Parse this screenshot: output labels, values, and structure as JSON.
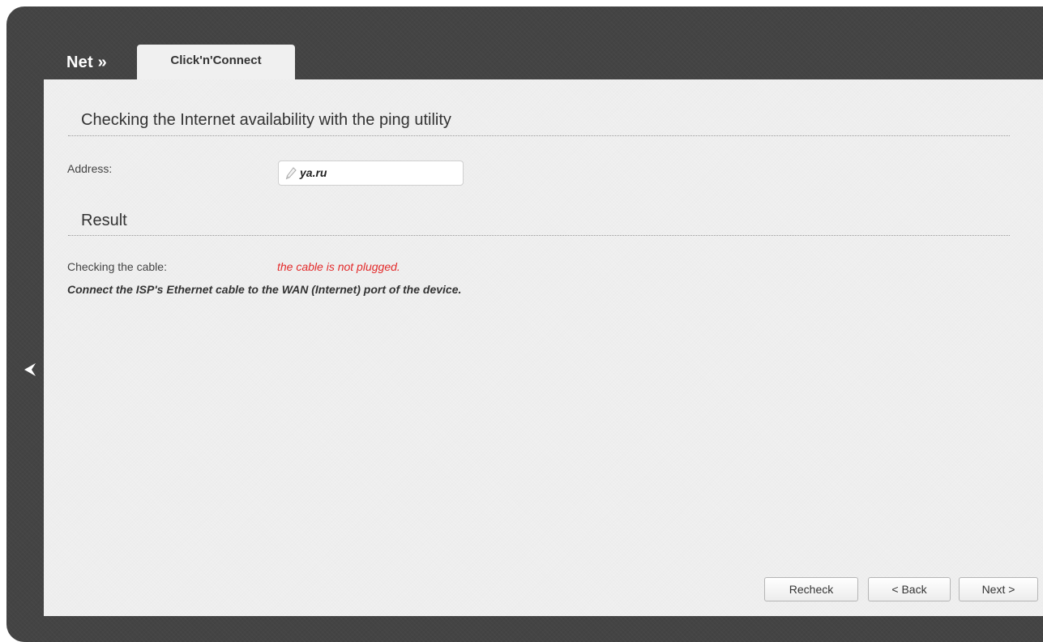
{
  "header": {
    "section": "Net »",
    "tab_label": "Click'n'Connect"
  },
  "ping_section": {
    "title": "Checking the Internet availability with the ping utility",
    "address_label": "Address:",
    "address_value": "ya.ru"
  },
  "result_section": {
    "title": "Result",
    "cable_label": "Checking the cable:",
    "cable_status": "the cable is not plugged.",
    "hint": "Connect the ISP's Ethernet cable to the WAN (Internet) port of the device.",
    "status_color": "#e32a2a"
  },
  "buttons": {
    "recheck": "Recheck",
    "back": "< Back",
    "next": "Next >"
  },
  "icons": {
    "address": "pencil-icon",
    "side_nav": "chevron-left-icon"
  }
}
